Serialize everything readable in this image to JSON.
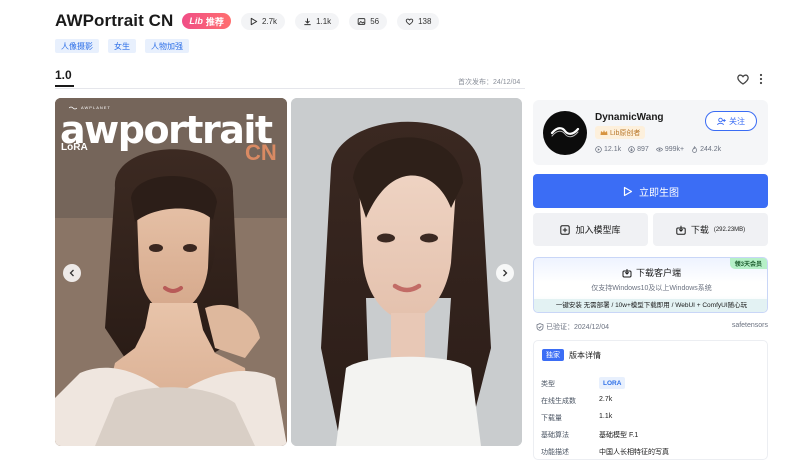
{
  "header": {
    "title": "AWPortrait CN",
    "lib_badge": "推荐",
    "lib_badge_prefix": "Lib",
    "stats": [
      {
        "icon": "play-icon",
        "value": "2.7k"
      },
      {
        "icon": "download-icon",
        "value": "1.1k"
      },
      {
        "icon": "image-icon",
        "value": "56"
      },
      {
        "icon": "heart-icon",
        "value": "138"
      }
    ]
  },
  "tags": [
    "人像摄影",
    "女生",
    "人物加强"
  ],
  "version": {
    "label": "1.0",
    "publish_label": "首次发布：24/12/04"
  },
  "gallery": {
    "poster_brand": "AWPLANET",
    "poster_title": "awportrait",
    "poster_lora": "LoRA",
    "poster_cn": "CN"
  },
  "author": {
    "name": "DynamicWang",
    "badge": "Lib原创者",
    "follow_label": "关注",
    "stats": [
      {
        "icon": "play-icon",
        "value": "12.1k"
      },
      {
        "icon": "download-icon",
        "value": "897"
      },
      {
        "icon": "eye-icon",
        "value": "999k+"
      },
      {
        "icon": "fire-icon",
        "value": "244.2k"
      }
    ]
  },
  "actions": {
    "generate": "立即生图",
    "add_library": "加入模型库",
    "download": "下载",
    "download_size": "(292.23MB)"
  },
  "client": {
    "ribbon": "领3天会员",
    "title": "下载客户端",
    "subtitle": "仅支持Windows10及以上Windows系统",
    "bar": "一键安装 无需部署 / 10w+模型下载即用 / WebUI + ComfyUI随心玩"
  },
  "meta": {
    "verified": "已验证：2024/12/04",
    "format": "safetensors"
  },
  "details": {
    "exclusive": "独家",
    "heading": "版本详情",
    "rows": [
      {
        "key": "类型",
        "value": "LORA"
      },
      {
        "key": "在线生成数",
        "value": "2.7k"
      },
      {
        "key": "下载量",
        "value": "1.1k"
      },
      {
        "key": "基础算法",
        "value": "基础模型 F.1"
      },
      {
        "key": "功能描述",
        "value": "中国人长相特征的写真"
      }
    ]
  },
  "colors": {
    "accent": "#3b6df5",
    "badge_pink": "#f04d86",
    "tag_blue": "#2d6fe8"
  }
}
